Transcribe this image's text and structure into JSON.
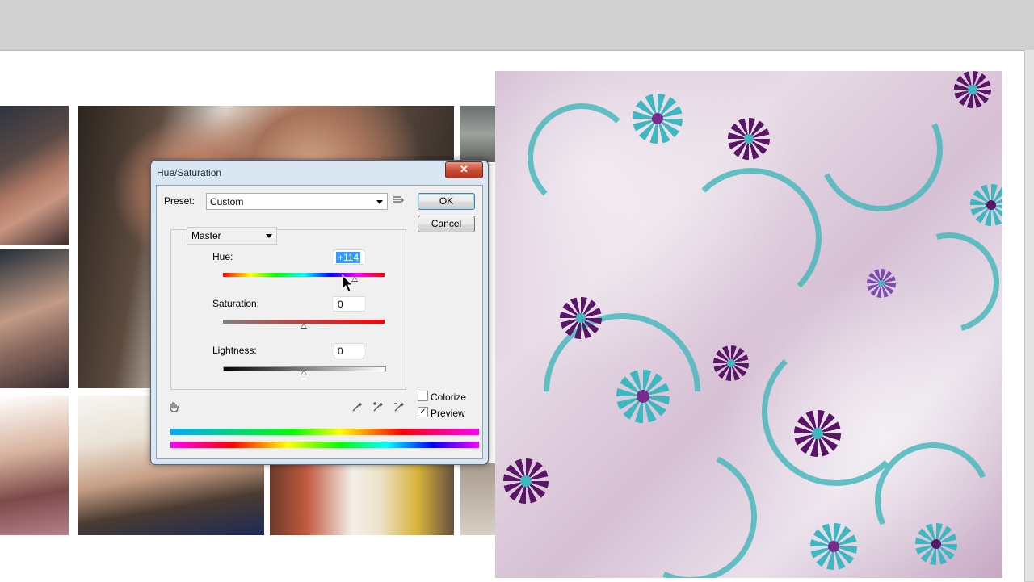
{
  "dialog": {
    "title": "Hue/Saturation",
    "close_label": "✕",
    "preset_label": "Preset:",
    "preset_value": "Custom",
    "ok_label": "OK",
    "cancel_label": "Cancel",
    "channel_value": "Master",
    "hue": {
      "label": "Hue:",
      "value": "+114",
      "level": 0.817
    },
    "saturation": {
      "label": "Saturation:",
      "value": "0",
      "level": 0.5
    },
    "lightness": {
      "label": "Lightness:",
      "value": "0",
      "level": 0.5
    },
    "colorize": {
      "label": "Colorize",
      "checked": false
    },
    "preview": {
      "label": "Preview",
      "checked": true,
      "mark": "✓"
    },
    "icons": [
      "preset-options-icon",
      "hand-adjust-icon",
      "eyedropper-icon",
      "eyedropper-plus-icon",
      "eyedropper-minus-icon"
    ]
  },
  "colors": {
    "dialog_bg": "#dbe6f3",
    "client_bg": "#f0f0f0",
    "close_red": "#c74f36",
    "selection_blue": "#3399ff",
    "pattern_teal": "#4ab9bc",
    "pattern_purple": "#5a1568"
  }
}
